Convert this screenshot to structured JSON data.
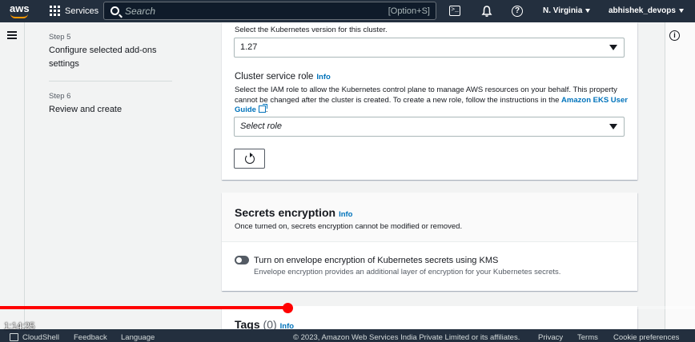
{
  "topbar": {
    "logo_text": "aws",
    "services_label": "Services",
    "search_placeholder": "Search",
    "search_shortcut": "[Option+S]",
    "region": "N. Virginia",
    "account": "abhishek_devops"
  },
  "steps": [
    {
      "label": "Step 5",
      "title_line1": "Configure selected add-ons",
      "title_line2": "settings"
    },
    {
      "label": "Step 6",
      "title_line1": "Review and create"
    }
  ],
  "cluster": {
    "version_hint": "Select the Kubernetes version for this cluster.",
    "version_value": "1.27",
    "role_label": "Cluster service role",
    "info_label": "Info",
    "role_desc_line1": "Select the IAM role to allow the Kubernetes control plane to manage AWS resources on your behalf. This property",
    "role_desc_line2": "cannot be changed after the cluster is created. To create a new role, follow the instructions in the",
    "role_link_part1": "Amazon EKS User",
    "role_link_part2": "Guide",
    "role_placeholder": "Select role"
  },
  "secrets": {
    "title": "Secrets encryption",
    "info_label": "Info",
    "desc": "Once turned on, secrets encryption cannot be modified or removed.",
    "toggle_label": "Turn on envelope encryption of Kubernetes secrets using KMS",
    "toggle_desc": "Envelope encryption provides an additional layer of encryption for your Kubernetes secrets.",
    "toggle_on": false
  },
  "tags": {
    "title": "Tags",
    "count": "(0)",
    "info_label": "Info"
  },
  "video": {
    "timecode": "1:14:25",
    "progress_fraction": 0.414
  },
  "footer": {
    "cloudshell": "CloudShell",
    "feedback": "Feedback",
    "language": "Language",
    "copyright": "© 2023, Amazon Web Services India Private Limited or its affiliates.",
    "privacy": "Privacy",
    "terms": "Terms",
    "cookies": "Cookie preferences"
  },
  "colors": {
    "nav_bg": "#232f3e",
    "link": "#0073bb",
    "accent_orange": "#ff9900",
    "progress_red": "#ff0000"
  }
}
